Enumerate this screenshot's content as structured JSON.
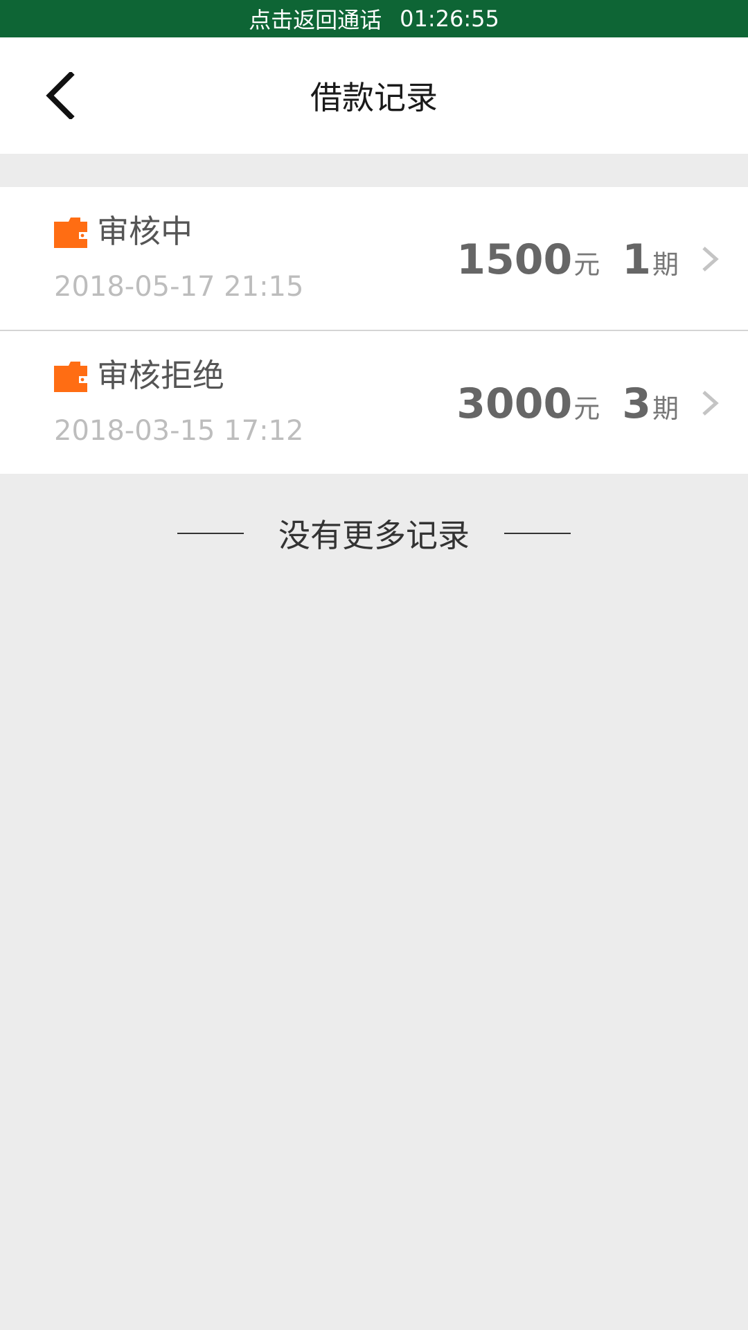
{
  "call_bar": {
    "text": "点击返回通话",
    "time": "01:26:55",
    "color": "#0e6535"
  },
  "nav": {
    "title": "借款记录",
    "back_icon": "chevron-left-icon"
  },
  "records": [
    {
      "status": "审核中",
      "date": "2018-05-17 21:15",
      "amount": "1500",
      "amount_unit": "元",
      "term": "1",
      "term_unit": "期",
      "icon": "wallet-icon"
    },
    {
      "status": "审核拒绝",
      "date": "2018-03-15 17:12",
      "amount": "3000",
      "amount_unit": "元",
      "term": "3",
      "term_unit": "期",
      "icon": "wallet-icon"
    }
  ],
  "footer": {
    "no_more": "没有更多记录"
  },
  "colors": {
    "accent": "#ff6d13",
    "background": "#ececec"
  }
}
